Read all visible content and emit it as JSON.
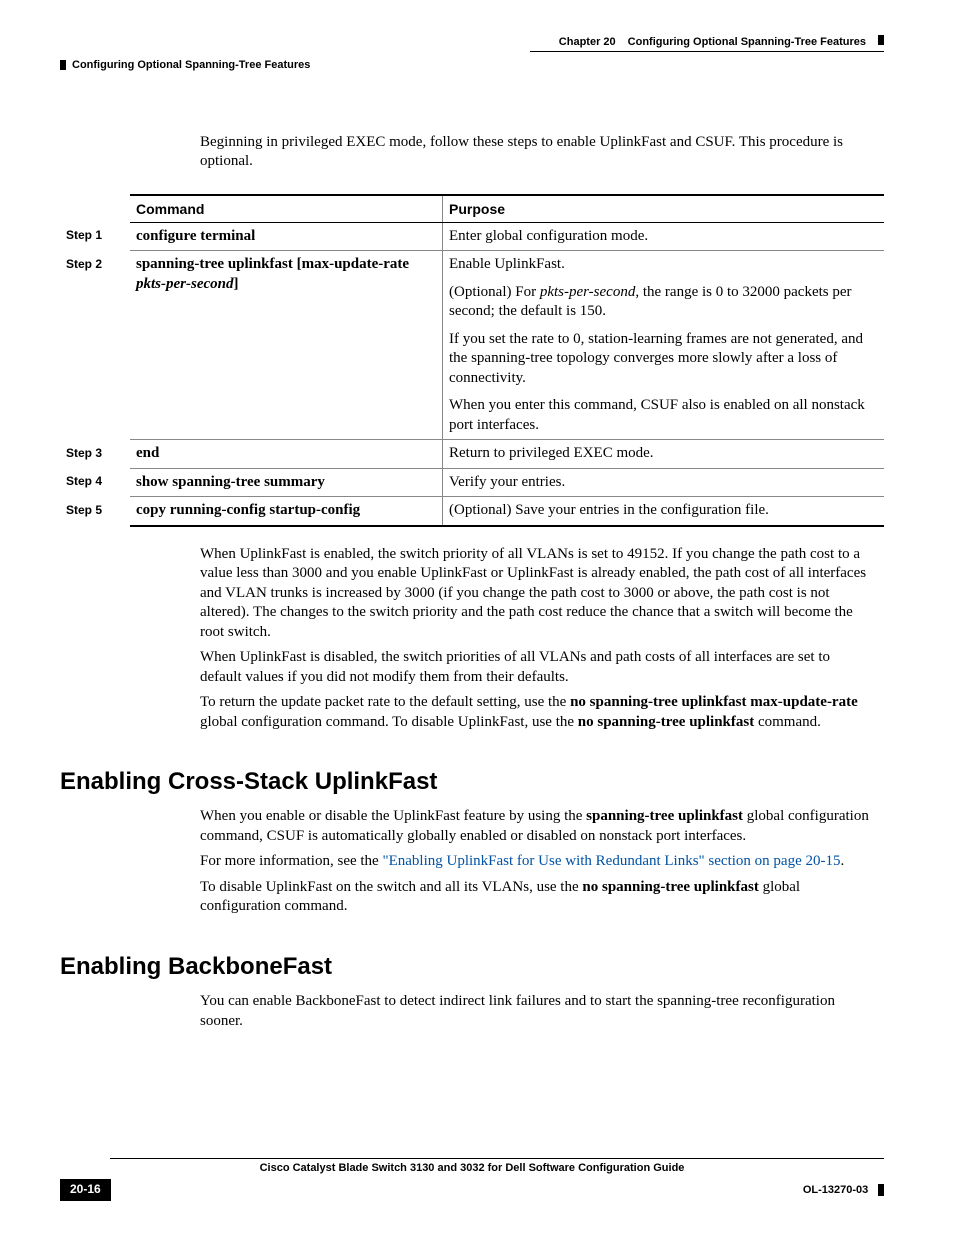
{
  "header": {
    "chapter": "Chapter 20",
    "title": "Configuring Optional Spanning-Tree Features",
    "subtitle": "Configuring Optional Spanning-Tree Features"
  },
  "intro": "Beginning in privileged EXEC mode, follow these steps to enable UplinkFast and CSUF. This procedure is optional.",
  "table": {
    "headers": {
      "command": "Command",
      "purpose": "Purpose"
    },
    "rows": [
      {
        "step": "Step 1",
        "command_bold": "configure terminal",
        "command_ital": "",
        "purpose": [
          "Enter global configuration mode."
        ]
      },
      {
        "step": "Step 2",
        "command_bold": "spanning-tree uplinkfast [max-update-rate",
        "command_ital": "pkts-per-second",
        "command_suffix": "]",
        "purpose": [
          "Enable UplinkFast.",
          "(Optional) For <em class=\"cmd-ital\">pkts-per-second</em>, the range is 0 to 32000 packets per second; the default is 150.",
          "If you set the rate to 0, station-learning frames are not generated, and the spanning-tree topology converges more slowly after a loss of connectivity.",
          "When you enter this command, CSUF also is enabled on all nonstack port interfaces."
        ]
      },
      {
        "step": "Step 3",
        "command_bold": "end",
        "command_ital": "",
        "purpose": [
          "Return to privileged EXEC mode."
        ]
      },
      {
        "step": "Step 4",
        "command_bold": "show spanning-tree summary",
        "command_ital": "",
        "purpose": [
          "Verify your entries."
        ]
      },
      {
        "step": "Step 5",
        "command_bold": "copy running-config startup-config",
        "command_ital": "",
        "purpose": [
          "(Optional) Save your entries in the configuration file."
        ]
      }
    ]
  },
  "after_table": {
    "p1": "When UplinkFast is enabled, the switch priority of all VLANs is set to 49152. If you change the path cost to a value less than 3000 and you enable UplinkFast or UplinkFast is already enabled, the path cost of all interfaces and VLAN trunks is increased by 3000 (if you change the path cost to 3000 or above, the path cost is not altered). The changes to the switch priority and the path cost reduce the chance that a switch will become the root switch.",
    "p2": "When UplinkFast is disabled, the switch priorities of all VLANs and path costs of all interfaces are set to default values if you did not modify them from their defaults.",
    "p3_pre": "To return the update packet rate to the default setting, use the ",
    "p3_b1": "no spanning-tree uplinkfast max-update-rate",
    "p3_mid": " global configuration command. To disable UplinkFast, use the ",
    "p3_b2": "no spanning-tree uplinkfast",
    "p3_post": " command."
  },
  "section1": {
    "heading": "Enabling Cross-Stack UplinkFast",
    "p1_pre": "When you enable or disable the UplinkFast feature by using the ",
    "p1_b": "spanning-tree uplinkfast",
    "p1_post": " global configuration command, CSUF is automatically globally enabled or disabled on nonstack port interfaces.",
    "p2_pre": "For more information, see the ",
    "p2_link": "\"Enabling UplinkFast for Use with Redundant Links\" section on page 20-15",
    "p2_post": ".",
    "p3_pre": "To disable UplinkFast on the switch and all its VLANs, use the ",
    "p3_b": "no spanning-tree uplinkfast",
    "p3_post": " global configuration command."
  },
  "section2": {
    "heading": "Enabling BackboneFast",
    "p1": "You can enable BackboneFast to detect indirect link failures and to start the spanning-tree reconfiguration sooner."
  },
  "footer": {
    "title": "Cisco Catalyst Blade Switch 3130 and 3032 for Dell Software Configuration Guide",
    "page": "20-16",
    "docid": "OL-13270-03"
  }
}
